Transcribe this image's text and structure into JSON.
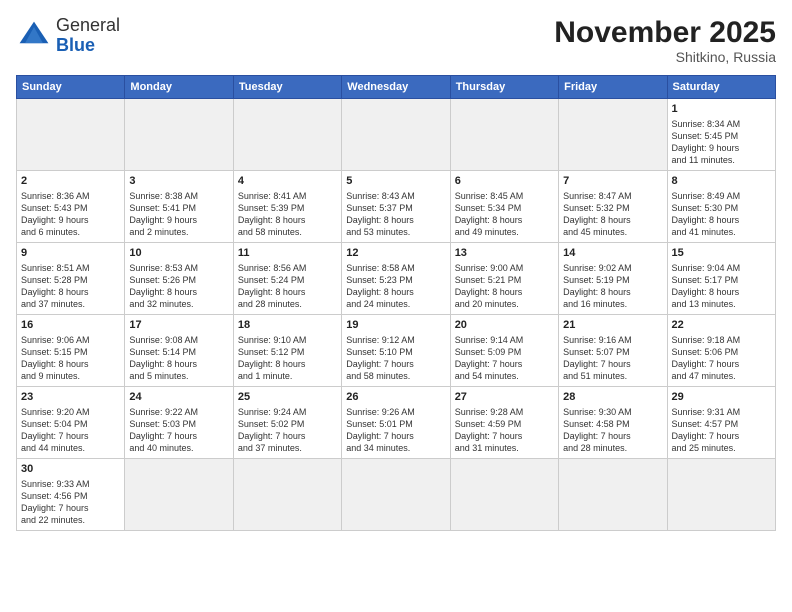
{
  "header": {
    "logo_general": "General",
    "logo_blue": "Blue",
    "month_title": "November 2025",
    "location": "Shitkino, Russia"
  },
  "weekdays": [
    "Sunday",
    "Monday",
    "Tuesday",
    "Wednesday",
    "Thursday",
    "Friday",
    "Saturday"
  ],
  "weeks": [
    [
      {
        "day": "",
        "info": "",
        "empty": true
      },
      {
        "day": "",
        "info": "",
        "empty": true
      },
      {
        "day": "",
        "info": "",
        "empty": true
      },
      {
        "day": "",
        "info": "",
        "empty": true
      },
      {
        "day": "",
        "info": "",
        "empty": true
      },
      {
        "day": "",
        "info": "",
        "empty": true
      },
      {
        "day": "1",
        "info": "Sunrise: 8:34 AM\nSunset: 5:45 PM\nDaylight: 9 hours\nand 11 minutes."
      }
    ],
    [
      {
        "day": "2",
        "info": "Sunrise: 8:36 AM\nSunset: 5:43 PM\nDaylight: 9 hours\nand 6 minutes."
      },
      {
        "day": "3",
        "info": "Sunrise: 8:38 AM\nSunset: 5:41 PM\nDaylight: 9 hours\nand 2 minutes."
      },
      {
        "day": "4",
        "info": "Sunrise: 8:41 AM\nSunset: 5:39 PM\nDaylight: 8 hours\nand 58 minutes."
      },
      {
        "day": "5",
        "info": "Sunrise: 8:43 AM\nSunset: 5:37 PM\nDaylight: 8 hours\nand 53 minutes."
      },
      {
        "day": "6",
        "info": "Sunrise: 8:45 AM\nSunset: 5:34 PM\nDaylight: 8 hours\nand 49 minutes."
      },
      {
        "day": "7",
        "info": "Sunrise: 8:47 AM\nSunset: 5:32 PM\nDaylight: 8 hours\nand 45 minutes."
      },
      {
        "day": "8",
        "info": "Sunrise: 8:49 AM\nSunset: 5:30 PM\nDaylight: 8 hours\nand 41 minutes."
      }
    ],
    [
      {
        "day": "9",
        "info": "Sunrise: 8:51 AM\nSunset: 5:28 PM\nDaylight: 8 hours\nand 37 minutes."
      },
      {
        "day": "10",
        "info": "Sunrise: 8:53 AM\nSunset: 5:26 PM\nDaylight: 8 hours\nand 32 minutes."
      },
      {
        "day": "11",
        "info": "Sunrise: 8:56 AM\nSunset: 5:24 PM\nDaylight: 8 hours\nand 28 minutes."
      },
      {
        "day": "12",
        "info": "Sunrise: 8:58 AM\nSunset: 5:23 PM\nDaylight: 8 hours\nand 24 minutes."
      },
      {
        "day": "13",
        "info": "Sunrise: 9:00 AM\nSunset: 5:21 PM\nDaylight: 8 hours\nand 20 minutes."
      },
      {
        "day": "14",
        "info": "Sunrise: 9:02 AM\nSunset: 5:19 PM\nDaylight: 8 hours\nand 16 minutes."
      },
      {
        "day": "15",
        "info": "Sunrise: 9:04 AM\nSunset: 5:17 PM\nDaylight: 8 hours\nand 13 minutes."
      }
    ],
    [
      {
        "day": "16",
        "info": "Sunrise: 9:06 AM\nSunset: 5:15 PM\nDaylight: 8 hours\nand 9 minutes."
      },
      {
        "day": "17",
        "info": "Sunrise: 9:08 AM\nSunset: 5:14 PM\nDaylight: 8 hours\nand 5 minutes."
      },
      {
        "day": "18",
        "info": "Sunrise: 9:10 AM\nSunset: 5:12 PM\nDaylight: 8 hours\nand 1 minute."
      },
      {
        "day": "19",
        "info": "Sunrise: 9:12 AM\nSunset: 5:10 PM\nDaylight: 7 hours\nand 58 minutes."
      },
      {
        "day": "20",
        "info": "Sunrise: 9:14 AM\nSunset: 5:09 PM\nDaylight: 7 hours\nand 54 minutes."
      },
      {
        "day": "21",
        "info": "Sunrise: 9:16 AM\nSunset: 5:07 PM\nDaylight: 7 hours\nand 51 minutes."
      },
      {
        "day": "22",
        "info": "Sunrise: 9:18 AM\nSunset: 5:06 PM\nDaylight: 7 hours\nand 47 minutes."
      }
    ],
    [
      {
        "day": "23",
        "info": "Sunrise: 9:20 AM\nSunset: 5:04 PM\nDaylight: 7 hours\nand 44 minutes."
      },
      {
        "day": "24",
        "info": "Sunrise: 9:22 AM\nSunset: 5:03 PM\nDaylight: 7 hours\nand 40 minutes."
      },
      {
        "day": "25",
        "info": "Sunrise: 9:24 AM\nSunset: 5:02 PM\nDaylight: 7 hours\nand 37 minutes."
      },
      {
        "day": "26",
        "info": "Sunrise: 9:26 AM\nSunset: 5:01 PM\nDaylight: 7 hours\nand 34 minutes."
      },
      {
        "day": "27",
        "info": "Sunrise: 9:28 AM\nSunset: 4:59 PM\nDaylight: 7 hours\nand 31 minutes."
      },
      {
        "day": "28",
        "info": "Sunrise: 9:30 AM\nSunset: 4:58 PM\nDaylight: 7 hours\nand 28 minutes."
      },
      {
        "day": "29",
        "info": "Sunrise: 9:31 AM\nSunset: 4:57 PM\nDaylight: 7 hours\nand 25 minutes."
      }
    ],
    [
      {
        "day": "30",
        "info": "Sunrise: 9:33 AM\nSunset: 4:56 PM\nDaylight: 7 hours\nand 22 minutes."
      },
      {
        "day": "",
        "info": "",
        "empty": true
      },
      {
        "day": "",
        "info": "",
        "empty": true
      },
      {
        "day": "",
        "info": "",
        "empty": true
      },
      {
        "day": "",
        "info": "",
        "empty": true
      },
      {
        "day": "",
        "info": "",
        "empty": true
      },
      {
        "day": "",
        "info": "",
        "empty": true
      }
    ]
  ]
}
